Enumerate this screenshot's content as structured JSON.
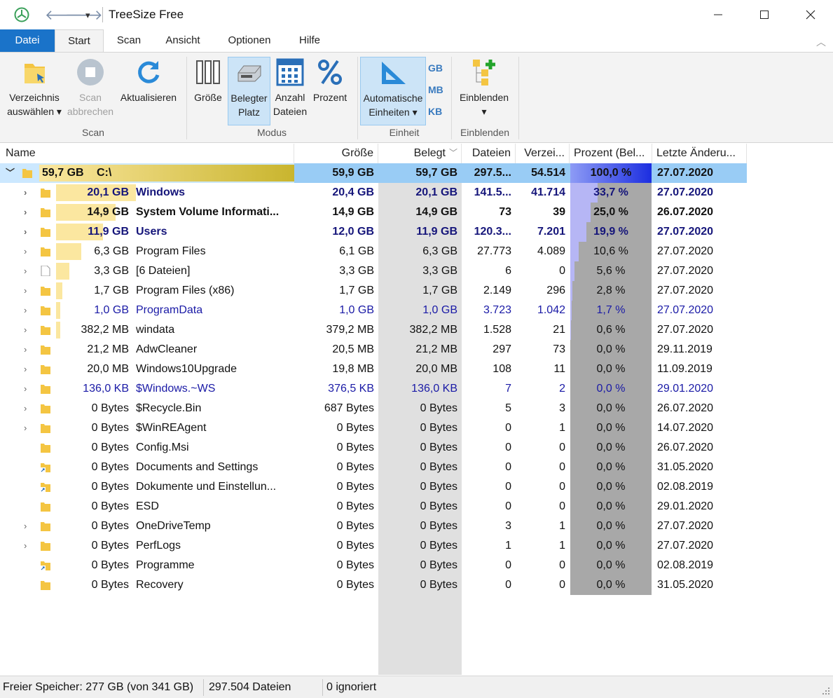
{
  "window": {
    "title": "TreeSize Free"
  },
  "tabs": [
    "Datei",
    "Start",
    "Scan",
    "Ansicht",
    "Optionen",
    "Hilfe"
  ],
  "ribbon": {
    "scan_group": "Scan",
    "modus_group": "Modus",
    "einheit_group": "Einheit",
    "einblenden_group": "Einblenden",
    "verzeichnis_l1": "Verzeichnis",
    "verzeichnis_l2": "auswählen ▾",
    "scan_abbrechen_l1": "Scan",
    "scan_abbrechen_l2": "abbrechen",
    "aktualisieren": "Aktualisieren",
    "groesse": "Größe",
    "belegter_l1": "Belegter",
    "belegter_l2": "Platz",
    "anzahl_l1": "Anzahl",
    "anzahl_l2": "Dateien",
    "prozent": "Prozent",
    "auto_l1": "Automatische",
    "auto_l2": "Einheiten ▾",
    "gb": "GB",
    "mb": "MB",
    "kb": "KB",
    "einblenden": "Einblenden",
    "einblenden_arrow": "▾"
  },
  "columns": {
    "name": "Name",
    "groesse": "Größe",
    "belegt": "Belegt",
    "dateien": "Dateien",
    "verz": "Verzei...",
    "prozent": "Prozent (Bel...",
    "datum": "Letzte Änderu..."
  },
  "root": {
    "size": "59,7 GB",
    "name": "C:\\",
    "groesse": "59,9 GB",
    "belegt": "59,7 GB",
    "dateien": "297.5...",
    "verz": "54.514",
    "pct": "100,0 %",
    "pct_value": 100.0,
    "date": "27.07.2020"
  },
  "rows": [
    {
      "size": "20,1 GB",
      "name": "Windows",
      "groesse": "20,4 GB",
      "belegt": "20,1 GB",
      "dateien": "141.5...",
      "verz": "41.714",
      "pct": "33,7 %",
      "pct_value": 33.7,
      "date": "27.07.2020",
      "style": "bold blue",
      "expand": true,
      "icon": "folder",
      "bar": 0.337
    },
    {
      "size": "14,9 GB",
      "name": "System Volume Informati...",
      "groesse": "14,9 GB",
      "belegt": "14,9 GB",
      "dateien": "73",
      "verz": "39",
      "pct": "25,0 %",
      "pct_value": 25.0,
      "date": "26.07.2020",
      "style": "bold",
      "expand": true,
      "icon": "folder",
      "bar": 0.25
    },
    {
      "size": "11,9 GB",
      "name": "Users",
      "groesse": "12,0 GB",
      "belegt": "11,9 GB",
      "dateien": "120.3...",
      "verz": "7.201",
      "pct": "19,9 %",
      "pct_value": 19.9,
      "date": "27.07.2020",
      "style": "bold blue",
      "expand": true,
      "icon": "folder",
      "bar": 0.199
    },
    {
      "size": "6,3 GB",
      "name": "Program Files",
      "groesse": "6,1 GB",
      "belegt": "6,3 GB",
      "dateien": "27.773",
      "verz": "4.089",
      "pct": "10,6 %",
      "pct_value": 10.6,
      "date": "27.07.2020",
      "style": "",
      "expand": true,
      "icon": "folder",
      "bar": 0.106
    },
    {
      "size": "3,3 GB",
      "name": "[6 Dateien]",
      "groesse": "3,3 GB",
      "belegt": "3,3 GB",
      "dateien": "6",
      "verz": "0",
      "pct": "5,6 %",
      "pct_value": 5.6,
      "date": "27.07.2020",
      "style": "",
      "expand": true,
      "icon": "file",
      "bar": 0.056
    },
    {
      "size": "1,7 GB",
      "name": "Program Files (x86)",
      "groesse": "1,7 GB",
      "belegt": "1,7 GB",
      "dateien": "2.149",
      "verz": "296",
      "pct": "2,8 %",
      "pct_value": 2.8,
      "date": "27.07.2020",
      "style": "",
      "expand": true,
      "icon": "folder",
      "bar": 0.028
    },
    {
      "size": "1,0 GB",
      "name": "ProgramData",
      "groesse": "1,0 GB",
      "belegt": "1,0 GB",
      "dateien": "3.723",
      "verz": "1.042",
      "pct": "1,7 %",
      "pct_value": 1.7,
      "date": "27.07.2020",
      "style": "blue",
      "expand": true,
      "icon": "folder",
      "bar": 0.017
    },
    {
      "size": "382,2 MB",
      "name": "windata",
      "groesse": "379,2 MB",
      "belegt": "382,2 MB",
      "dateien": "1.528",
      "verz": "21",
      "pct": "0,6 %",
      "pct_value": 0.6,
      "date": "27.07.2020",
      "style": "",
      "expand": true,
      "icon": "folder",
      "bar": 0.006
    },
    {
      "size": "21,2 MB",
      "name": "AdwCleaner",
      "groesse": "20,5 MB",
      "belegt": "21,2 MB",
      "dateien": "297",
      "verz": "73",
      "pct": "0,0 %",
      "pct_value": 0.0,
      "date": "29.11.2019",
      "style": "",
      "expand": true,
      "icon": "folder",
      "bar": 0
    },
    {
      "size": "20,0 MB",
      "name": "Windows10Upgrade",
      "groesse": "19,8 MB",
      "belegt": "20,0 MB",
      "dateien": "108",
      "verz": "11",
      "pct": "0,0 %",
      "pct_value": 0.0,
      "date": "11.09.2019",
      "style": "",
      "expand": true,
      "icon": "folder",
      "bar": 0
    },
    {
      "size": "136,0 KB",
      "name": "$Windows.~WS",
      "groesse": "376,5 KB",
      "belegt": "136,0 KB",
      "dateien": "7",
      "verz": "2",
      "pct": "0,0 %",
      "pct_value": 0.0,
      "date": "29.01.2020",
      "style": "blue",
      "expand": true,
      "icon": "folder",
      "bar": 0
    },
    {
      "size": "0 Bytes",
      "name": "$Recycle.Bin",
      "groesse": "687 Bytes",
      "belegt": "0 Bytes",
      "dateien": "5",
      "verz": "3",
      "pct": "0,0 %",
      "pct_value": 0.0,
      "date": "26.07.2020",
      "style": "",
      "expand": true,
      "icon": "folder",
      "bar": 0
    },
    {
      "size": "0 Bytes",
      "name": "$WinREAgent",
      "groesse": "0 Bytes",
      "belegt": "0 Bytes",
      "dateien": "0",
      "verz": "1",
      "pct": "0,0 %",
      "pct_value": 0.0,
      "date": "14.07.2020",
      "style": "",
      "expand": true,
      "icon": "folder",
      "bar": 0
    },
    {
      "size": "0 Bytes",
      "name": "Config.Msi",
      "groesse": "0 Bytes",
      "belegt": "0 Bytes",
      "dateien": "0",
      "verz": "0",
      "pct": "0,0 %",
      "pct_value": 0.0,
      "date": "26.07.2020",
      "style": "",
      "expand": false,
      "icon": "folder",
      "bar": 0
    },
    {
      "size": "0 Bytes",
      "name": "Documents and Settings",
      "groesse": "0 Bytes",
      "belegt": "0 Bytes",
      "dateien": "0",
      "verz": "0",
      "pct": "0,0 %",
      "pct_value": 0.0,
      "date": "31.05.2020",
      "style": "",
      "expand": false,
      "icon": "link",
      "bar": 0
    },
    {
      "size": "0 Bytes",
      "name": "Dokumente und Einstellun...",
      "groesse": "0 Bytes",
      "belegt": "0 Bytes",
      "dateien": "0",
      "verz": "0",
      "pct": "0,0 %",
      "pct_value": 0.0,
      "date": "02.08.2019",
      "style": "",
      "expand": false,
      "icon": "link",
      "bar": 0
    },
    {
      "size": "0 Bytes",
      "name": "ESD",
      "groesse": "0 Bytes",
      "belegt": "0 Bytes",
      "dateien": "0",
      "verz": "0",
      "pct": "0,0 %",
      "pct_value": 0.0,
      "date": "29.01.2020",
      "style": "",
      "expand": false,
      "icon": "folder",
      "bar": 0
    },
    {
      "size": "0 Bytes",
      "name": "OneDriveTemp",
      "groesse": "0 Bytes",
      "belegt": "0 Bytes",
      "dateien": "3",
      "verz": "1",
      "pct": "0,0 %",
      "pct_value": 0.0,
      "date": "27.07.2020",
      "style": "",
      "expand": true,
      "icon": "folder",
      "bar": 0
    },
    {
      "size": "0 Bytes",
      "name": "PerfLogs",
      "groesse": "0 Bytes",
      "belegt": "0 Bytes",
      "dateien": "1",
      "verz": "1",
      "pct": "0,0 %",
      "pct_value": 0.0,
      "date": "27.07.2020",
      "style": "",
      "expand": true,
      "icon": "folder",
      "bar": 0
    },
    {
      "size": "0 Bytes",
      "name": "Programme",
      "groesse": "0 Bytes",
      "belegt": "0 Bytes",
      "dateien": "0",
      "verz": "0",
      "pct": "0,0 %",
      "pct_value": 0.0,
      "date": "02.08.2019",
      "style": "",
      "expand": false,
      "icon": "link",
      "bar": 0
    },
    {
      "size": "0 Bytes",
      "name": "Recovery",
      "groesse": "0 Bytes",
      "belegt": "0 Bytes",
      "dateien": "0",
      "verz": "0",
      "pct": "0,0 %",
      "pct_value": 0.0,
      "date": "31.05.2020",
      "style": "",
      "expand": false,
      "icon": "folder",
      "bar": 0
    }
  ],
  "status": {
    "free": "Freier Speicher: 277 GB  (von 341 GB)",
    "files": "297.504 Dateien",
    "ignored": "0 ignoriert"
  }
}
